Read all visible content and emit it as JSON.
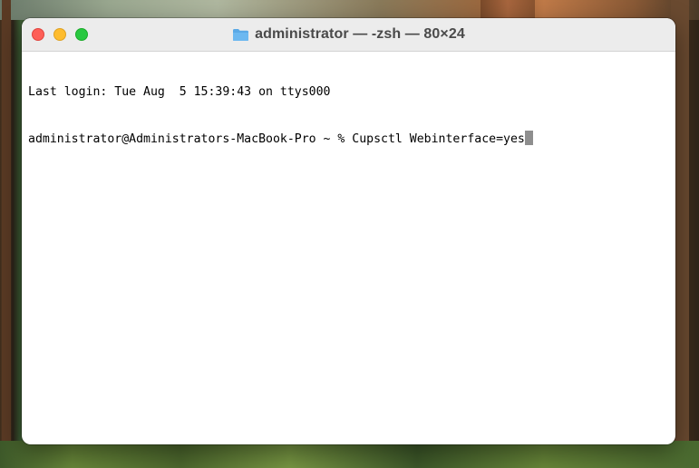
{
  "window": {
    "title": "administrator — -zsh — 80×24",
    "folder_icon": "folder-icon",
    "traffic_lights": {
      "close_color": "#fe5f57",
      "minimize_color": "#febc2e",
      "zoom_color": "#28c840"
    }
  },
  "terminal": {
    "last_login": "Last login: Tue Aug  5 15:39:43 on ttys000",
    "prompt": "administrator@Administrators-MacBook-Pro ~ % ",
    "command": "Cupsctl Webinterface=yes",
    "cursor_color": "#8e8e8e"
  }
}
